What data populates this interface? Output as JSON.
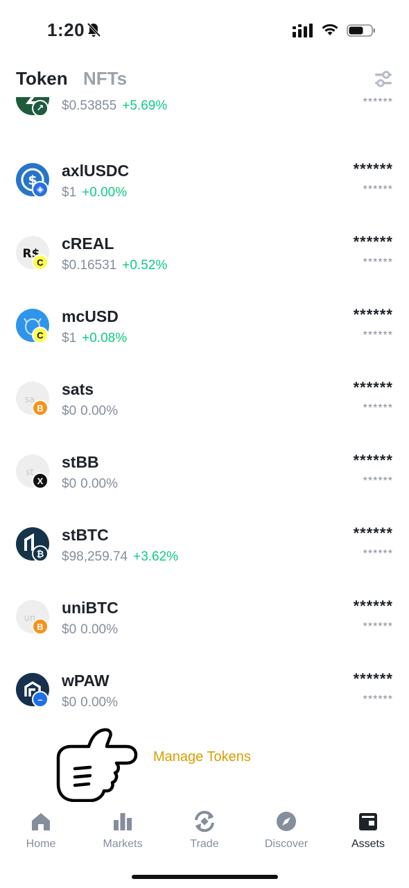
{
  "status_bar": {
    "time": "1:20"
  },
  "tabs": {
    "token": "Token",
    "nfts": "NFTs"
  },
  "tokens": [
    {
      "symbol": "",
      "price": "$0.53855",
      "change": "+5.69%",
      "trend": "up",
      "balance": "",
      "balance_usd": "******",
      "logo_color": "#1e5a3c"
    },
    {
      "symbol": "axlUSDC",
      "price": "$1",
      "change": "+0.00%",
      "trend": "up",
      "balance": "******",
      "balance_usd": "******",
      "logo_color": "#2775ca",
      "badge_color": "#2b6fe0"
    },
    {
      "symbol": "cREAL",
      "price": "$0.16531",
      "change": "+0.52%",
      "trend": "up",
      "balance": "******",
      "balance_usd": "******",
      "logo_color": "#eeeeee",
      "logo_text": "R$",
      "badge_text": "C",
      "badge_color": "#fcff52"
    },
    {
      "symbol": "mcUSD",
      "price": "$1",
      "change": "+0.08%",
      "trend": "up",
      "balance": "******",
      "balance_usd": "******",
      "logo_color": "#2d95ea",
      "badge_text": "C",
      "badge_color": "#fcff52"
    },
    {
      "symbol": "sats",
      "price": "$0",
      "change": "0.00%",
      "trend": "flat",
      "balance": "******",
      "balance_usd": "******",
      "logo_color": "#eeeeee",
      "logo_text": "sa",
      "badge_text": "B",
      "badge_color": "#f7931a"
    },
    {
      "symbol": "stBB",
      "price": "$0",
      "change": "0.00%",
      "trend": "flat",
      "balance": "******",
      "balance_usd": "******",
      "logo_color": "#eeeeee",
      "logo_text": "st",
      "badge_text": "X",
      "badge_color": "#111111"
    },
    {
      "symbol": "stBTC",
      "price": "$98,259.74",
      "change": "+3.62%",
      "trend": "up",
      "balance": "******",
      "balance_usd": "******",
      "logo_color": "#15344a",
      "badge_text": "₿",
      "badge_color": "#15344a"
    },
    {
      "symbol": "uniBTC",
      "price": "$0",
      "change": "0.00%",
      "trend": "flat",
      "balance": "******",
      "balance_usd": "******",
      "logo_color": "#eeeeee",
      "logo_text": "un",
      "badge_text": "B",
      "badge_color": "#f7931a"
    },
    {
      "symbol": "wPAW",
      "price": "$0",
      "change": "0.00%",
      "trend": "flat",
      "balance": "******",
      "balance_usd": "******",
      "logo_color": "#16304d",
      "badge_text": "–",
      "badge_color": "#1f6fe6"
    }
  ],
  "manage": {
    "label": "Manage Tokens"
  },
  "nav": {
    "home": "Home",
    "markets": "Markets",
    "trade": "Trade",
    "discover": "Discover",
    "assets": "Assets"
  },
  "colors": {
    "up": "#0ecb81",
    "muted": "#848e9c",
    "link": "#d89f00",
    "text": "#1e2329"
  }
}
